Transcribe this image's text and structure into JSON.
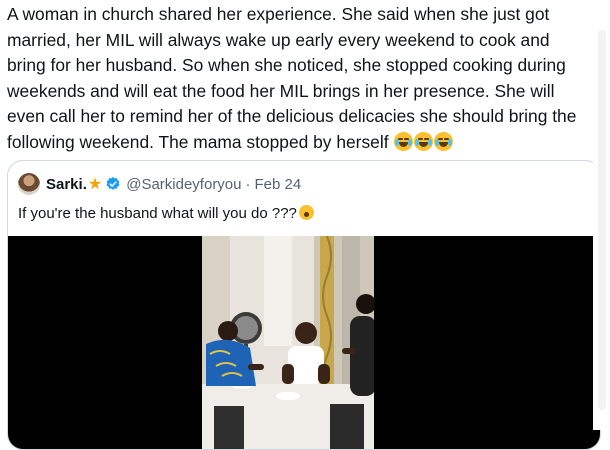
{
  "post": {
    "text": "A woman in church shared her experience. She said when she just got married, her MIL will always wake up early every weekend to cook and bring for her husband. So when she noticed, she stopped cooking during weekends and will eat the food her MIL brings in her presence. She will even call her to remind her of the delicious delicacies she should bring the following weekend. The mama stopped by herself",
    "emojis": [
      "joy-emoji",
      "joy-emoji",
      "joy-emoji"
    ]
  },
  "quote": {
    "author_name": "Sarki.",
    "star_icon": "★",
    "handle": "@Sarkideyforyou",
    "separator": "·",
    "date": "Feb 24",
    "text": "If you're the husband what will you do ???",
    "verified_color": "#1d9bf0"
  },
  "media": {
    "type": "video",
    "description_icon": "video-thumbnail"
  }
}
